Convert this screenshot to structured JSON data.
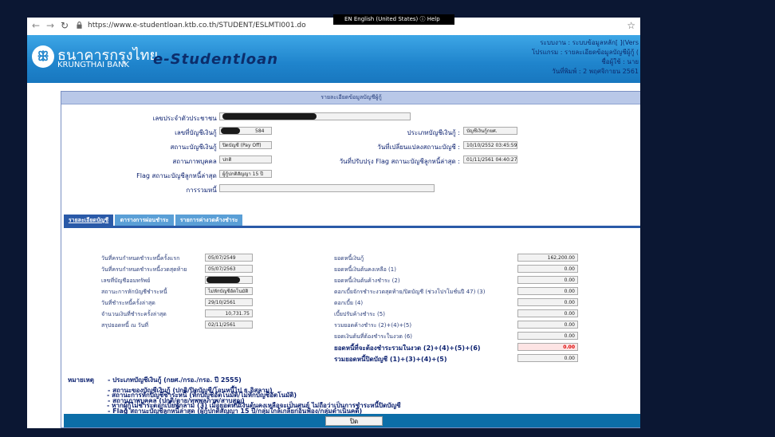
{
  "browser": {
    "url": "https://www.e-studentloan.ktb.co.th/STUDENT/ESLMTI001.do",
    "lang_overlay": "EN English (United States)  ⓘ Help"
  },
  "banner": {
    "bank_th": "ธนาคารกรุงไทย",
    "bank_en": "KRUNGTHAI BANK",
    "app_name": "e-Studentloan",
    "system": "ระบบงาน : ระบบข้อมูลหลัก[ ](Vers",
    "program": "โปรแกรม : รายละเอียดข้อมูลบัญชีผู้กู้ (",
    "user": "ชื่อผู้ใช้ : นาย",
    "print_date": "วันที่พิมพ์ : 2 พฤศจิกายน 2561"
  },
  "panel": {
    "title": "รายละเอียดข้อมูลบัญชีผู้กู้",
    "id_label": "เลขประจำตัวประชาชน :",
    "account_no_label": "เลขที่บัญชีเงินกู้ :",
    "account_no_value": "584",
    "account_type_label": "ประเภทบัญชีเงินกู้ :",
    "account_type_value": "บัญชีเงินกู้กยศ.",
    "account_status_label": "สถานะบัญชีเงินกู้ :",
    "account_status_value": "ปิดบัญชี (Pay Off)",
    "status_change_date_label": "วันที่เปลี่ยนแปลงสถานะบัญชี :",
    "status_change_date_value": "10/10/2552 03:45:59",
    "person_status_label": "สถานภาพบุคคล :",
    "person_status_value": "ปกติ",
    "flag_update_label": "วันที่ปรับปรุง Flag สถานะบัญชีลูกหนี้ล่าสุด :",
    "flag_update_value": "01/11/2561 04:40:27",
    "flag_label": "Flag สถานะบัญชีลูกหนี้ล่าสุด :",
    "flag_value": "ผู้กู้ปกติสัญญา 15 ปี",
    "guarantee_label": "การรวมหนี้ :"
  },
  "tabs": [
    {
      "label": "รายละเอียดบัญชี"
    },
    {
      "label": "ตารางการผ่อนชำระ"
    },
    {
      "label": "รายการค่างวดค้างชำระ"
    }
  ],
  "details_left": [
    {
      "label": "วันที่ครบกำหนดชำระหนี้ครั้งแรก",
      "value": "05/07/2549"
    },
    {
      "label": "วันที่ครบกำหนดชำระหนี้งวดสุดท้าย",
      "value": "05/07/2563"
    },
    {
      "label": "เลขที่บัญชีออมทรัพย์",
      "value": ""
    },
    {
      "label": "สถานะการหักบัญชีชำระหนี้",
      "value": "ไม่หักบัญชีอัตโนมัติ"
    },
    {
      "label": "วันที่ชำระหนี้ครั้งล่าสุด",
      "value": "29/10/2561"
    },
    {
      "label": "จำนวนเงินที่ชำระครั้งล่าสุด",
      "value": "10,731.75"
    },
    {
      "label": "สรุปยอดหนี้ ณ วันที่",
      "value": "02/11/2561"
    }
  ],
  "details_right": [
    {
      "label": "ยอดหนี้เงินกู้",
      "value": "162,200.00"
    },
    {
      "label": "ยอดหนี้เงินต้นคงเหลือ (1)",
      "value": "0.00"
    },
    {
      "label": "ยอดหนี้เงินต้นค้างชำระ (2)",
      "value": "0.00"
    },
    {
      "label": "ดอกเบี้ยจักรชำระงวดสุดท้าย/ปิดบัญชี (ช่วงโปรโมชั่นปี 47) (3)",
      "value": "0.00"
    },
    {
      "label": "ดอกเบี้ย (4)",
      "value": "0.00"
    },
    {
      "label": "เบี้ยปรับค้างชำระ (5)",
      "value": "0.00"
    },
    {
      "label": "รวมยอดค้างชำระ (2)+(4)+(5)",
      "value": "0.00"
    },
    {
      "label": "ยอดเงินต้นที่ต้องชำระในงวด (6)",
      "value": "0.00"
    },
    {
      "label": "ยอดหนี้ที่จะต้องชำระรวมในงวด  (2)+(4)+(5)+(6)",
      "value": "0.00"
    },
    {
      "label": "รวมยอดหนี้ปิดบัญชี (1)+(3)+(4)+(5)",
      "value": "0.00"
    }
  ],
  "notes": {
    "title": "หมายเหตุ",
    "items": [
      "- ประเภทบัญชีเงินกู้ (กยศ./กรอ./กรอ. ปี 2555)",
      "- สถานะของบัญชีเงินกู้ (ปกติ/ปิดบัญชี/โอนหนี้ไป ธ.อิสลาม)",
      "- สถานภาพบุคคล (ปกติ/ตาย/ทุพพลภาพ/สาบสูญ)",
      "- Flag สถานะบัญชีลูกหนี้ล่าสุด (ผู้กู้ปกติสัญญา 15 ปี/กลุ่มใกล้เกลี่ยก่อนฟ้อง/กลุ่มดำเนินคดี)",
      "- สถานะการหักบัญชีชำระหนี้ (หักบัญชีอัตโนมัติ/ไม่หักบัญชีอัตโนมัติ)",
      "- หากผู้กู้ไม่ชำระดอกเบี้ยพักลาม (3) เมื่อยอดหนี้เงินต้นคงเหลือจะเป็นศูนย์ ไม่ถือว่าเป็นการชำระหนี้ปิดบัญชี"
    ]
  },
  "footer": {
    "close_label": "ปิด"
  }
}
